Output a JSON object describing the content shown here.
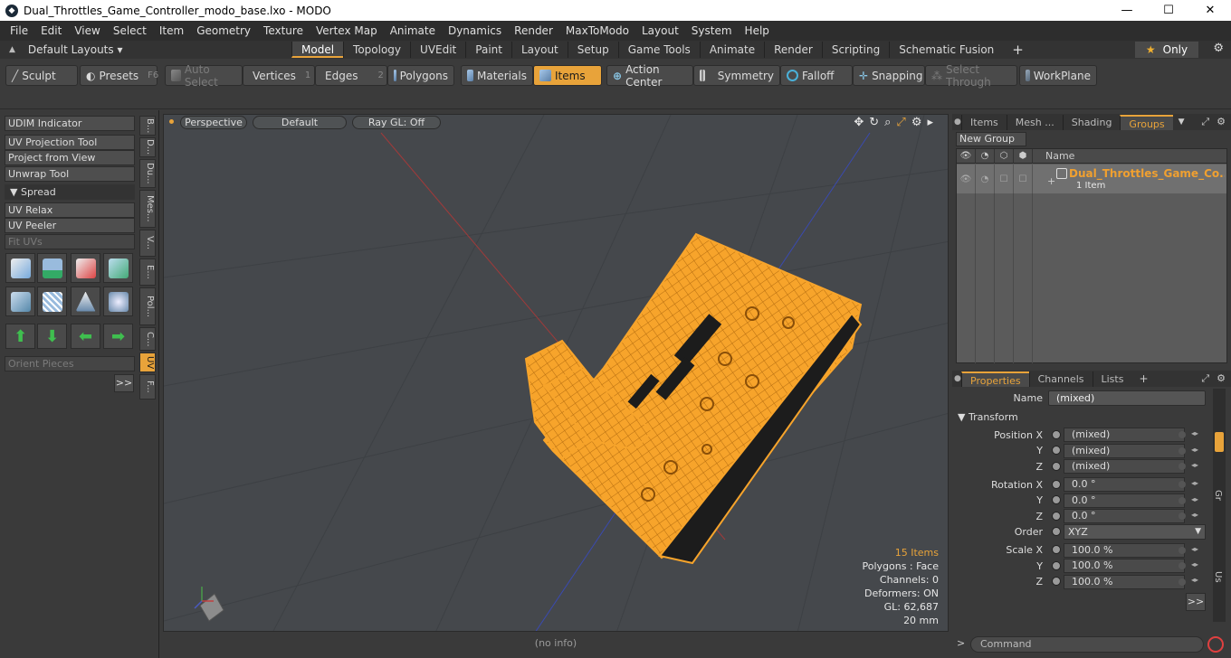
{
  "window": {
    "title": "Dual_Throttles_Game_Controller_modo_base.lxo - MODO",
    "min_icon": "—",
    "max_icon": "☐",
    "close_icon": "✕"
  },
  "menu": [
    "File",
    "Edit",
    "View",
    "Select",
    "Item",
    "Geometry",
    "Texture",
    "Vertex Map",
    "Animate",
    "Dynamics",
    "Render",
    "MaxToModo",
    "Layout",
    "System",
    "Help"
  ],
  "layouts": {
    "label": "Default Layouts ▾",
    "tabs": [
      "Model",
      "Topology",
      "UVEdit",
      "Paint",
      "Layout",
      "Setup",
      "Game Tools",
      "Animate",
      "Render",
      "Scripting",
      "Schematic Fusion"
    ],
    "active_tab": "Model",
    "only_label": "Only"
  },
  "toolbar": {
    "sculpt": "Sculpt",
    "presets": "Presets",
    "presets_key": "F6",
    "auto_select": "Auto Select",
    "vertices": "Vertices",
    "vertices_num": "1",
    "edges": "Edges",
    "edges_num": "2",
    "polygons": "Polygons",
    "materials": "Materials",
    "items": "Items",
    "action_center": "Action Center",
    "symmetry": "Symmetry",
    "falloff": "Falloff",
    "snapping": "Snapping",
    "select_through": "Select Through",
    "workplane": "WorkPlane"
  },
  "left_panel": {
    "udim": "UDIM Indicator",
    "uv_projection": "UV Projection Tool",
    "project_from_view": "Project from View",
    "unwrap_tool": "Unwrap Tool",
    "spread": "Spread",
    "uv_relax": "UV Relax",
    "uv_peeler": "UV Peeler",
    "fit_uvs": "Fit UVs",
    "orient_pieces": "Orient Pieces",
    "more": ">>",
    "vtabs": [
      "B...",
      "D...",
      "Du...",
      "Mes...",
      "V...",
      "E...",
      "Pol...",
      "C...",
      "UV",
      "F..."
    ]
  },
  "viewport": {
    "view": "Perspective",
    "shading": "Default",
    "raygl": "Ray GL: Off",
    "items_count": "15 Items",
    "polygons": "Polygons : Face",
    "channels": "Channels: 0",
    "deformers": "Deformers: ON",
    "gl": "GL: 62,687",
    "scale": "20 mm",
    "status": "(no info)",
    "model_color": "#f7a42b"
  },
  "right_panel": {
    "tabs": [
      "Items",
      "Mesh ...",
      "Shading",
      "Groups"
    ],
    "active_tab": "Groups",
    "new_group": "New Group",
    "name_col": "Name",
    "group_name": "Dual_Throttles_Game_Co...",
    "group_count": "1 Item",
    "prop_tabs": [
      "Properties",
      "Channels",
      "Lists"
    ],
    "active_prop_tab": "Properties",
    "name_label": "Name",
    "name_value": "(mixed)",
    "transform_label": "Transform",
    "position_x_label": "Position X",
    "y_label": "Y",
    "z_label": "Z",
    "pos_x": "(mixed)",
    "pos_y": "(mixed)",
    "pos_z": "(mixed)",
    "rotation_x_label": "Rotation X",
    "rot_x": "0.0 °",
    "rot_y": "0.0 °",
    "rot_z": "0.0 °",
    "order_label": "Order",
    "order_value": "XYZ",
    "scale_x_label": "Scale X",
    "scale_x": "100.0 %",
    "scale_y": "100.0 %",
    "scale_z": "100.0 %",
    "more": ">>",
    "side_gr": "Gr",
    "side_us": "Us",
    "command_placeholder": "Command"
  }
}
